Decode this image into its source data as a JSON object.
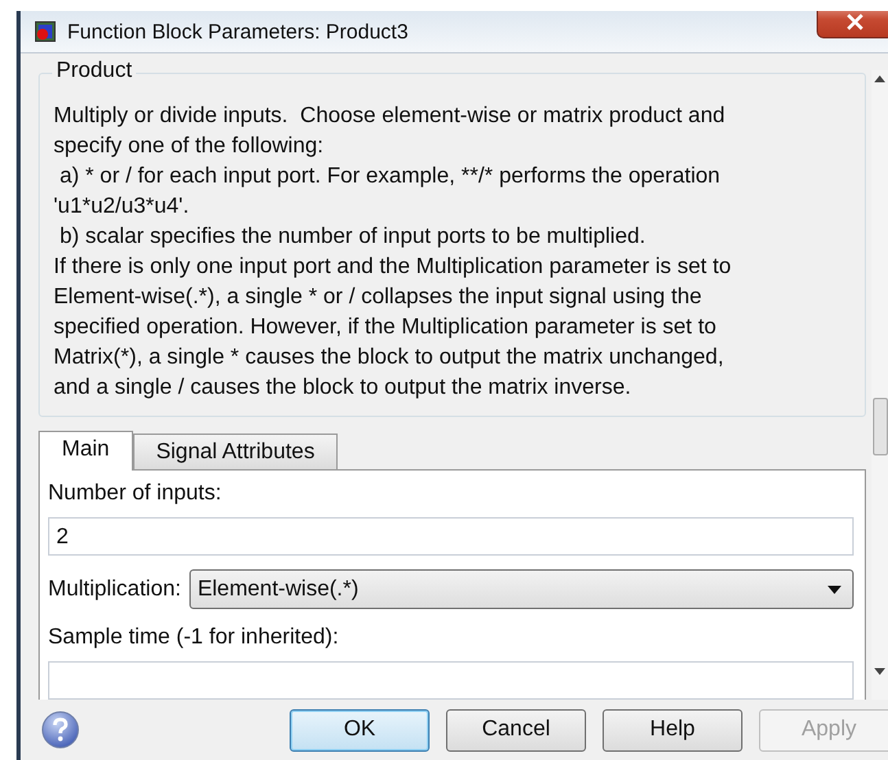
{
  "window": {
    "title": "Function Block Parameters: Product3"
  },
  "group": {
    "title": "Product",
    "description_lines": [
      "Multiply or divide inputs.  Choose element-wise or matrix product and",
      "specify one of the following:",
      " a) * or / for each input port. For example, **/* performs the operation",
      "'u1*u2/u3*u4'.",
      " b) scalar specifies the number of input ports to be multiplied.",
      "If there is only one input port and the Multiplication parameter is set to",
      "Element-wise(.*), a single * or / collapses the input signal using the",
      "specified operation. However, if the Multiplication parameter is set to",
      "Matrix(*), a single * causes the block to output the matrix unchanged,",
      "and a single / causes the block to output the matrix inverse."
    ]
  },
  "tabs": [
    {
      "label": "Main",
      "selected": true
    },
    {
      "label": "Signal Attributes",
      "selected": false
    }
  ],
  "params": [
    {
      "kind": "text",
      "label": "Number of inputs:",
      "value": "2"
    },
    {
      "kind": "select",
      "label": "Multiplication:",
      "value": "Element-wise(.*)"
    },
    {
      "kind": "text",
      "label": "Sample time (-1 for inherited):"
    }
  ],
  "buttons": [
    {
      "label": "OK",
      "default": true,
      "disabled": false
    },
    {
      "label": "Cancel",
      "default": false,
      "disabled": false
    },
    {
      "label": "Help",
      "default": false,
      "disabled": false
    },
    {
      "label": "Apply",
      "default": false,
      "disabled": true
    }
  ]
}
